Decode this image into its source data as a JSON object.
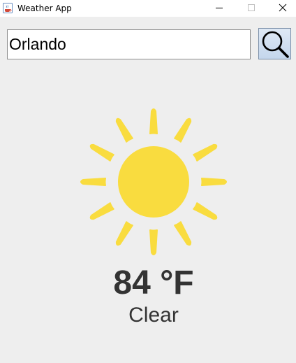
{
  "window": {
    "title": "Weather App",
    "app_icon": "java-cup-icon",
    "controls": {
      "minimize_icon": "minimize-icon",
      "maximize_icon": "maximize-icon",
      "close_icon": "close-icon"
    }
  },
  "search": {
    "value": "Orlando",
    "button_icon": "search-icon"
  },
  "weather": {
    "icon": "sun-icon",
    "icon_color": "#f9dc3f",
    "temperature": "84 °F",
    "condition": "Clear"
  },
  "colors": {
    "background": "#eeeeee",
    "text": "#333333",
    "sun": "#f9dc3f"
  }
}
